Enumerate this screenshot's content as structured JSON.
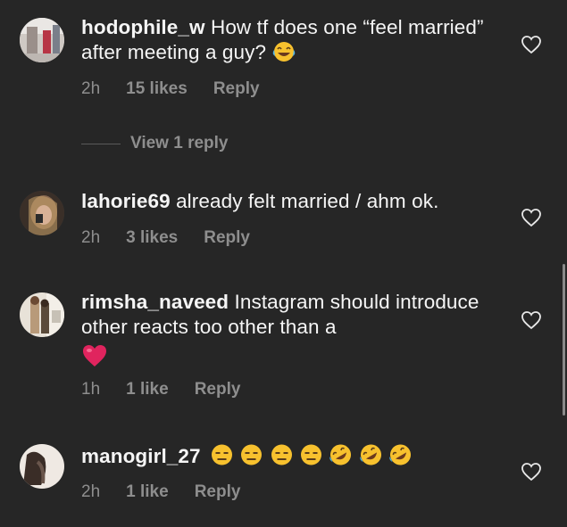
{
  "comments": [
    {
      "username": "hodophile_w",
      "text": "How tf does one “feel married” after meeting a guy?",
      "emoji": "face-with-tears-of-joy",
      "time": "2h",
      "likes": "15 likes",
      "reply": "Reply",
      "view_replies": "View 1 reply"
    },
    {
      "username": "lahorie69",
      "text": "already felt married / ahm ok.",
      "time": "2h",
      "likes": "3 likes",
      "reply": "Reply"
    },
    {
      "username": "rimsha_naveed",
      "text": "Instagram should introduce other reacts too other than a",
      "emoji": "red-heart",
      "time": "1h",
      "likes": "1 like",
      "reply": "Reply"
    },
    {
      "username": "manogirl_27",
      "text": "",
      "emojis": [
        "expressionless-face",
        "expressionless-face",
        "expressionless-face",
        "expressionless-face",
        "rolling-on-floor-laughing",
        "rolling-on-floor-laughing",
        "rolling-on-floor-laughing"
      ],
      "time": "2h",
      "likes": "1 like",
      "reply": "Reply"
    }
  ],
  "icons": {
    "like": "heart-outline-icon"
  },
  "colors": {
    "background": "#262626",
    "text": "#f5f5f5",
    "meta": "#8e8e8e",
    "heart_emoji": "#e0245e",
    "emoji_yellow": "#f7c12e"
  }
}
